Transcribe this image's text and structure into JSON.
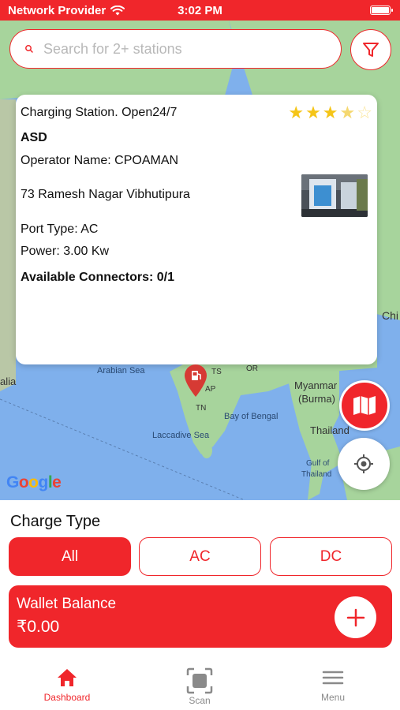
{
  "status_bar": {
    "carrier": "Network Provider",
    "time": "3:02 PM"
  },
  "search": {
    "placeholder": "Search for 2+ stations"
  },
  "map_labels": {
    "arabian_sea": "Arabian Sea",
    "bay_of_bengal": "Bay of Bengal",
    "laccadive_sea": "Laccadive Sea",
    "myanmar": "Myanmar",
    "burma": "(Burma)",
    "thailand": "Thailand",
    "gulf_of_thailand_1": "Gulf of",
    "gulf_of_thailand_2": "Thailand",
    "ts": "TS",
    "or": "OR",
    "ap": "AP",
    "tn": "TN",
    "chi": "Chi",
    "alia": "alia",
    "google": "Google"
  },
  "station": {
    "title": "Charging Station. Open24/7",
    "name": "ASD",
    "operator": "Operator Name:  CPOAMAN",
    "address": "73 Ramesh Nagar Vibhutipura",
    "port_type": "Port Type: AC",
    "power": "Power: 3.00 Kw",
    "connectors": "Available Connectors: 0/1",
    "rating": 3.5,
    "rating_max": 5
  },
  "charge_type": {
    "title": "Charge Type",
    "options": [
      "All",
      "AC",
      "DC"
    ],
    "selected": "All"
  },
  "wallet": {
    "label": "Wallet Balance",
    "amount": "₹0.00"
  },
  "tabbar": {
    "tabs": [
      {
        "label": "Dashboard",
        "icon": "home-icon",
        "active": true
      },
      {
        "label": "Scan",
        "icon": "scan-icon",
        "active": false
      },
      {
        "label": "Menu",
        "icon": "menu-icon",
        "active": false
      }
    ]
  },
  "colors": {
    "accent": "#f0262b",
    "map_water": "#7fb0ec",
    "map_land": "#a7d49c"
  }
}
